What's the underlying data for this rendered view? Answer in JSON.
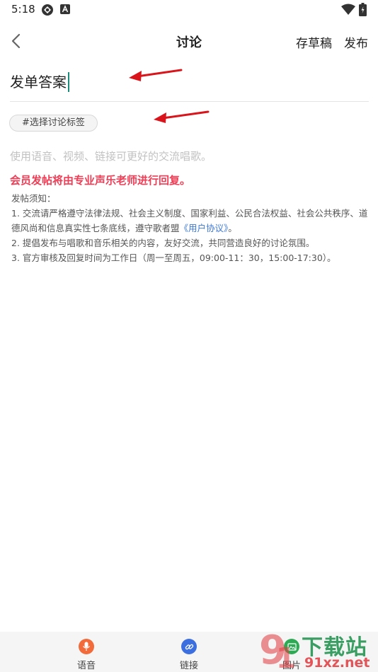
{
  "status_bar": {
    "time": "5:18",
    "icons": [
      "sync-icon",
      "a-badge-icon",
      "wifi-icon",
      "battery-icon"
    ]
  },
  "header": {
    "back_icon": "chevron-left-icon",
    "title": "讨论",
    "save_draft_label": "存草稿",
    "publish_label": "发布"
  },
  "title_input": {
    "value": "发单答案"
  },
  "tag_selector": {
    "label": "#选择讨论标签"
  },
  "content": {
    "placeholder": "使用语音、视频、链接可更好的交流唱歌。",
    "member_notice": "会员发帖将由专业声乐老师进行回复。",
    "rules_heading": "发帖须知：",
    "rule_1_text": "1. 交流请严格遵守法律法规、社会主义制度、国家利益、公民合法权益、社会公共秩序、道德风尚和信息真实性七条底线，遵守歌者盟",
    "rule_1_link": "《用户协议》",
    "rule_1_end": "。",
    "rule_2": "2. 提倡发布与唱歌和音乐相关的内容，友好交流，共同营造良好的讨论氛围。",
    "rule_3": "3. 官方审核及回复时间为工作日（周一至周五，09:00-11：30，15:00-17:30）。"
  },
  "toolbar": {
    "items": [
      {
        "label": "语音",
        "icon": "microphone-icon",
        "color": "#f26b3a"
      },
      {
        "label": "链接",
        "icon": "link-icon",
        "color": "#3b6fe0"
      },
      {
        "label": "图片",
        "icon": "image-icon",
        "color": "#2eaa55"
      }
    ]
  },
  "watermark": {
    "brand": "下载站",
    "domain": "91xz.net"
  },
  "colors": {
    "accent_red": "#ef3d55",
    "link_blue": "#3b78d8",
    "arrow_red": "#d9141b",
    "caret": "#1e8a7a"
  }
}
